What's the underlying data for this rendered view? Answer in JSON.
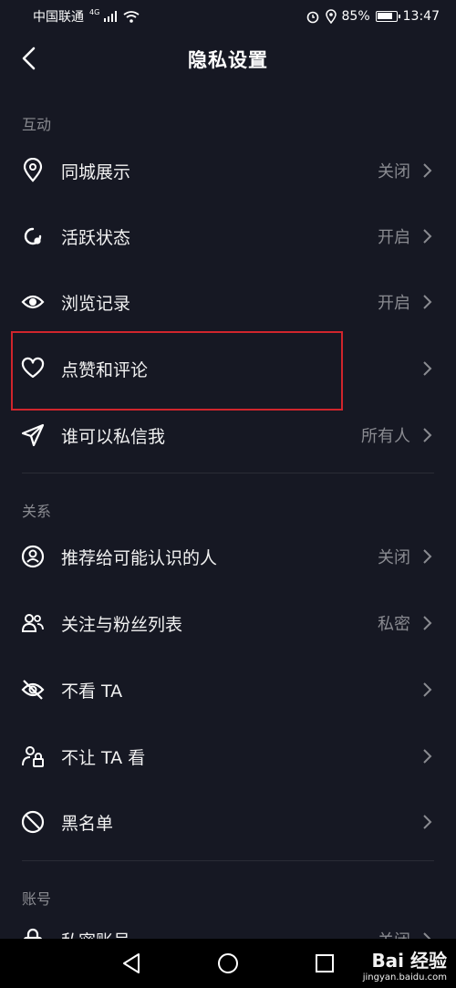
{
  "status": {
    "carrier": "中国联通",
    "network": "4G",
    "battery": "85%",
    "time": "13:47"
  },
  "header": {
    "title": "隐私设置"
  },
  "sections": [
    {
      "title": "互动"
    },
    {
      "title": "关系"
    },
    {
      "title": "账号"
    }
  ],
  "interaction": [
    {
      "label": "同城展示",
      "value": "关闭",
      "icon": "location-pin-icon"
    },
    {
      "label": "活跃状态",
      "value": "开启",
      "icon": "activity-status-icon"
    },
    {
      "label": "浏览记录",
      "value": "开启",
      "icon": "eye-icon"
    },
    {
      "label": "点赞和评论",
      "value": "",
      "icon": "heart-icon"
    },
    {
      "label": "谁可以私信我",
      "value": "所有人",
      "icon": "send-icon"
    }
  ],
  "relations": [
    {
      "label": "推荐给可能认识的人",
      "value": "关闭",
      "icon": "user-circle-icon"
    },
    {
      "label": "关注与粉丝列表",
      "value": "私密",
      "icon": "users-icon"
    },
    {
      "label": "不看 TA",
      "value": "",
      "icon": "eye-off-icon"
    },
    {
      "label": "不让 TA 看",
      "value": "",
      "icon": "user-lock-icon"
    },
    {
      "label": "黑名单",
      "value": "",
      "icon": "block-icon"
    }
  ],
  "account_partial": [
    {
      "label": "私密账号",
      "value": "关闭"
    }
  ],
  "watermark": {
    "brand": "Bai 经验",
    "url": "jingyan.baidu.com"
  },
  "colors": {
    "background": "#161823",
    "highlight": "#d0252c",
    "muted": "#8a8b91"
  }
}
